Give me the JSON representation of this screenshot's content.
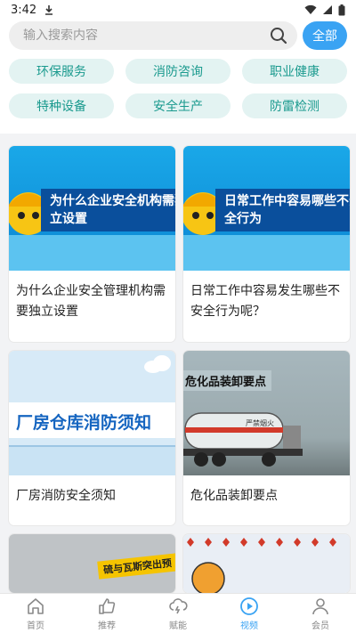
{
  "status_bar": {
    "time": "3:42"
  },
  "search": {
    "placeholder": "输入搜索内容",
    "all_button": "全部"
  },
  "categories": [
    "环保服务",
    "消防咨询",
    "职业健康",
    "特种设备",
    "安全生产",
    "防雷检测"
  ],
  "videos": [
    {
      "title": "为什么企业安全管理机构需要独立设置",
      "thumb_text": "为什么企业安全机构需独立设置"
    },
    {
      "title": "日常工作中容易发生哪些不安全行为呢？",
      "thumb_text": "日常工作中容易哪些不安全行为"
    },
    {
      "title": "厂房消防安全须知",
      "thumb_text": "厂房仓库消防须知"
    },
    {
      "title": "危化品装卸要点",
      "thumb_text": "危化品装卸要点",
      "tank_text": "严禁烟火"
    },
    {
      "thumb_text": "硫与瓦斯突出预"
    },
    {
      "thumb_text": ""
    }
  ],
  "nav": [
    {
      "label": "首页",
      "icon": "home-icon"
    },
    {
      "label": "推荐",
      "icon": "thumbs-up-icon"
    },
    {
      "label": "赋能",
      "icon": "cloud-lightning-icon"
    },
    {
      "label": "视频",
      "icon": "play-circle-icon",
      "active": true
    },
    {
      "label": "会员",
      "icon": "user-icon"
    }
  ],
  "colors": {
    "accent": "#3aa3f3",
    "chip_bg": "#e3f3f2",
    "chip_text": "#1a9a8e"
  }
}
